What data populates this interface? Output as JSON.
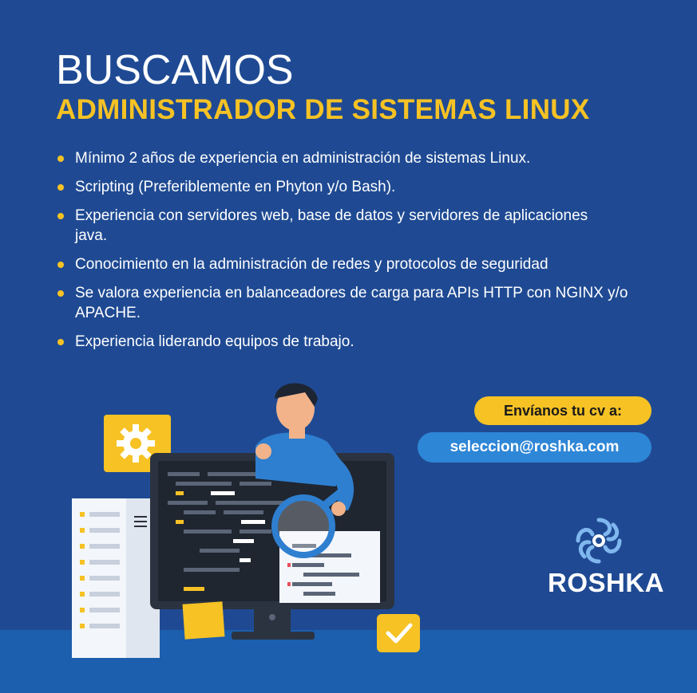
{
  "headline": "BUSCAMOS",
  "subheadline": "ADMINISTRADOR DE SISTEMAS LINUX",
  "requirements": [
    "Mínimo 2 años de experiencia en administración de sistemas Linux.",
    "Scripting (Preferiblemente en Phyton y/o Bash).",
    "Experiencia con servidores web, base de datos y servidores de aplicaciones java.",
    "Conocimiento en la administración de redes y protocolos de seguridad",
    "Se valora experiencia en balanceadores de carga para APIs HTTP con NGINX y/o APACHE.",
    "Experiencia liderando equipos de trabajo."
  ],
  "cta": {
    "label": "Envíanos tu cv a:",
    "email": "seleccion@roshka.com"
  },
  "brand": {
    "name": "ROSHKA",
    "colors": {
      "background": "#1f4a93",
      "accent": "#f6c224",
      "pill": "#2e86d6",
      "band": "#1b5fae"
    }
  },
  "illustration": {
    "icons": [
      "gear-icon",
      "server-rack-icon",
      "monitor-icon",
      "magnifier-icon",
      "checkmark-icon",
      "sticky-note-icon",
      "person-figure"
    ]
  }
}
